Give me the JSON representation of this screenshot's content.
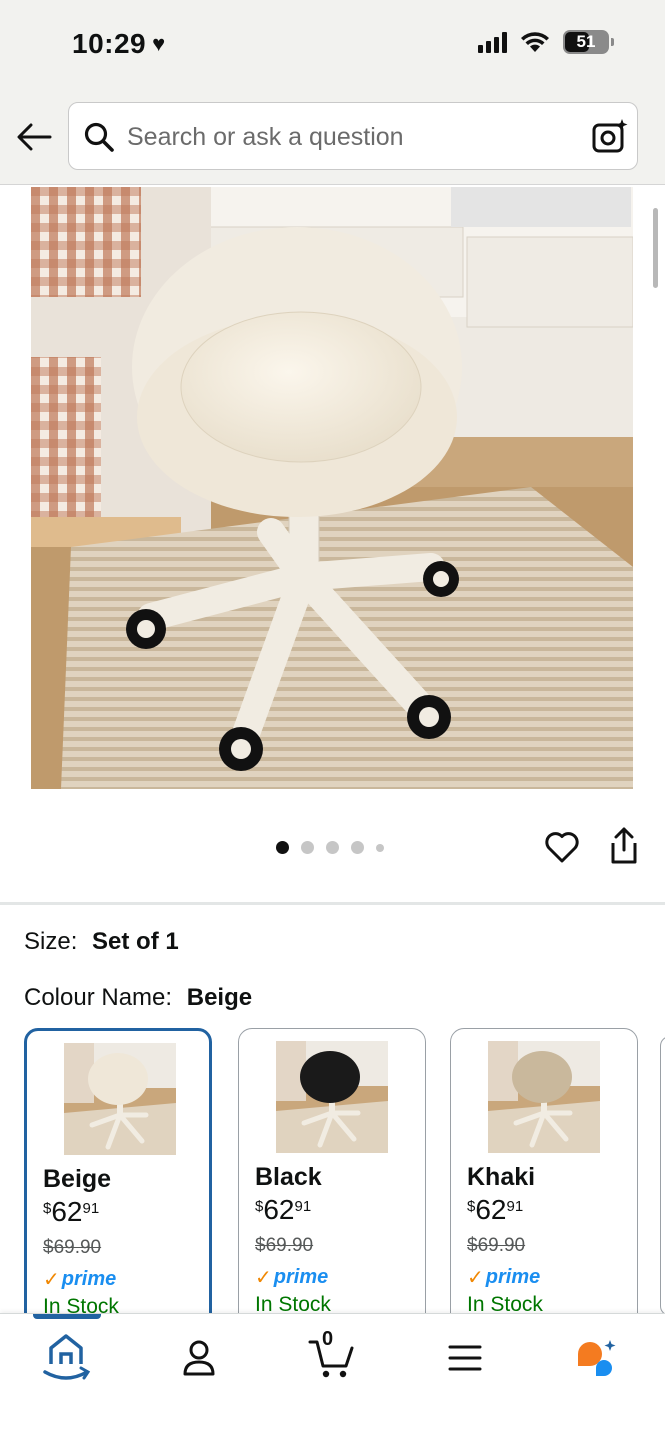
{
  "status_bar": {
    "time": "10:29",
    "battery": "51"
  },
  "search": {
    "placeholder": "Search or ask a question"
  },
  "gallery": {
    "image_count": 5,
    "active_index": 0
  },
  "variations": {
    "size_label": "Size:",
    "size_value": "Set of 1",
    "colour_label": "Colour Name:",
    "colour_value": "Beige",
    "options": [
      {
        "name": "Beige",
        "currency": "$",
        "whole": "62",
        "fraction": "91",
        "old_price": "$69.90",
        "prime": "prime",
        "stock": "In Stock",
        "seat_color": "#efe7d8"
      },
      {
        "name": "Black",
        "currency": "$",
        "whole": "62",
        "fraction": "91",
        "old_price": "$69.90",
        "prime": "prime",
        "stock": "In Stock",
        "seat_color": "#1a1a1a"
      },
      {
        "name": "Khaki",
        "currency": "$",
        "whole": "62",
        "fraction": "91",
        "old_price": "$69.90",
        "prime": "prime",
        "stock": "In Stock",
        "seat_color": "#c9b89c"
      }
    ]
  },
  "nav": {
    "cart_count": "0"
  },
  "colors": {
    "accent": "#2162a1",
    "stock_green": "#007600",
    "prime_blue": "#1a8ef0",
    "prime_orange": "#f08804"
  }
}
